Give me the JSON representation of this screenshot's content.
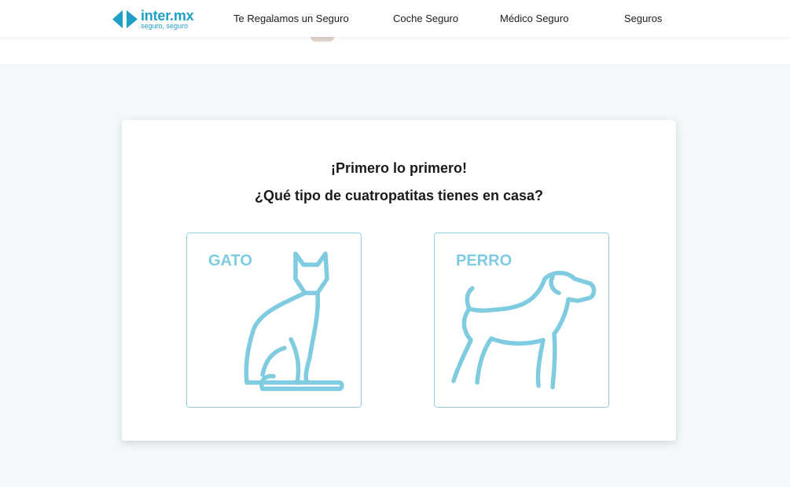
{
  "header": {
    "logo": {
      "name": "inter.mx",
      "tagline": "seguro, seguro"
    },
    "nav": [
      {
        "label": "Te Regalamos un Seguro"
      },
      {
        "label": "Coche Seguro"
      },
      {
        "label": "Médico Seguro"
      },
      {
        "label": "Seguros"
      }
    ]
  },
  "card": {
    "heading": "¡Primero lo primero!",
    "question": "¿Qué tipo de cuatropatitas tienes en casa?",
    "options": [
      {
        "label": "GATO",
        "icon": "cat-icon"
      },
      {
        "label": "PERRO",
        "icon": "dog-icon"
      }
    ]
  },
  "colors": {
    "brand": "#1f9fc5",
    "accent": "#7fcbe0",
    "page_background": "#f3f9fb"
  }
}
